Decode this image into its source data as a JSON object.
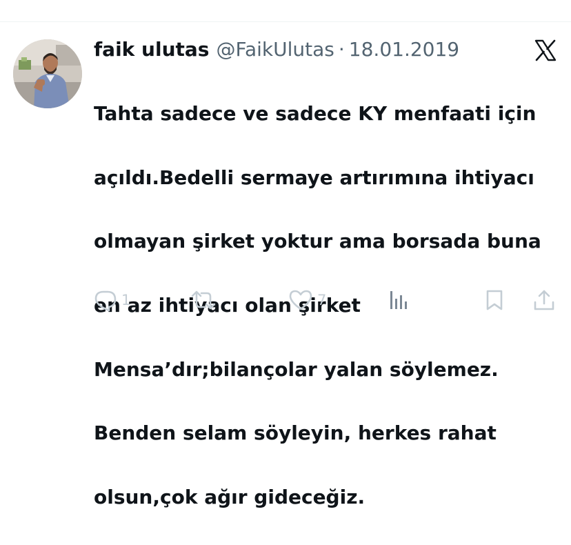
{
  "tweet": {
    "author_name": "faik ulutas",
    "author_handle": "@FaikUlutas",
    "separator": "·",
    "date": "18.01.2019",
    "text_lines": [
      "Tahta sadece ve sadece KY menfaati için",
      "açıldı.Bedelli sermaye artırımına ihtiyacı",
      "olmayan şirket yoktur ama borsada buna",
      "en az ihtiyacı olan şirket",
      "Mensa’dır;bilançolar yalan söylemez.",
      "Benden selam söyleyin, herkes rahat",
      "olsun,çok ağır gideceğiz."
    ]
  },
  "actions": {
    "reply": {
      "icon": "reply-icon",
      "count": "1"
    },
    "retweet": {
      "icon": "retweet-icon",
      "count": ""
    },
    "like": {
      "icon": "heart-icon",
      "count": "7"
    },
    "views": {
      "icon": "views-icon"
    },
    "bookmark": {
      "icon": "bookmark-icon"
    },
    "share": {
      "icon": "share-icon"
    }
  },
  "colors": {
    "text": "#0f1419",
    "secondary": "#536471",
    "action_icons": "#c4cdd4",
    "divider": "#eff3f4"
  }
}
